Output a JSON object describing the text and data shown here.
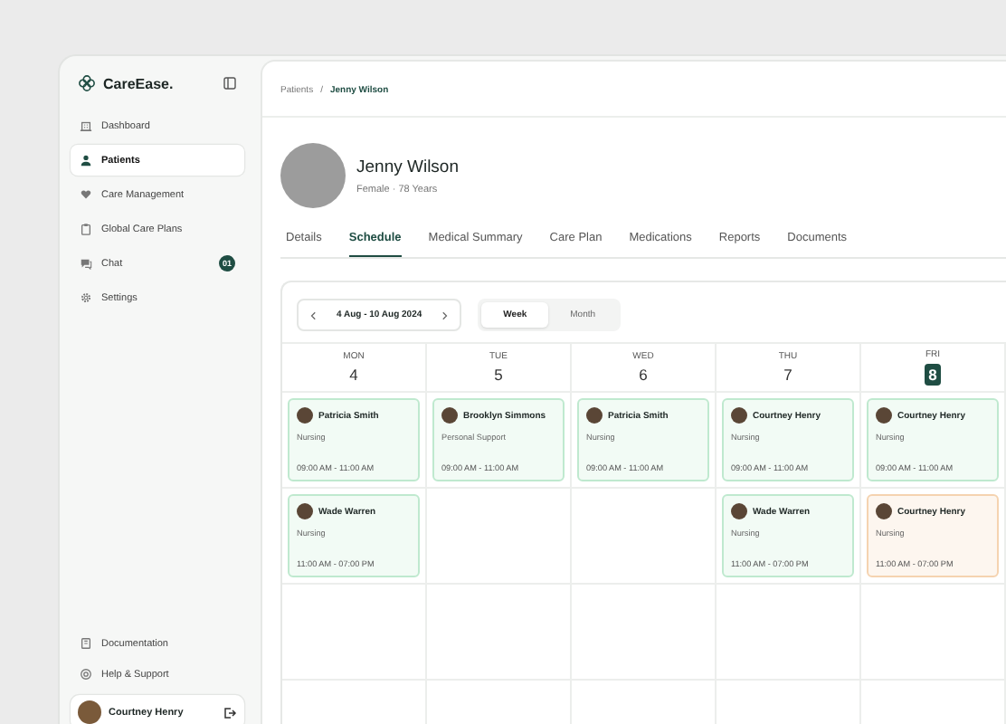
{
  "sidebar": {
    "brand": "CareEase.",
    "items": [
      {
        "label": "Dashboard",
        "selected": false
      },
      {
        "label": "Patients",
        "selected": true
      },
      {
        "label": "Care Management",
        "selected": false
      },
      {
        "label": "Global Care Plans",
        "selected": false
      },
      {
        "label": "Chat",
        "selected": false,
        "badge": "01"
      },
      {
        "label": "Settings",
        "selected": false
      }
    ],
    "footer_items": [
      {
        "label": "Documentation"
      },
      {
        "label": "Help & Support"
      }
    ],
    "user": {
      "name": "Courtney Henry"
    }
  },
  "breadcrumb": {
    "separator": "/",
    "items": [
      {
        "label": "Patients",
        "current": false
      },
      {
        "label": "Jenny Wilson",
        "current": true
      }
    ]
  },
  "patient": {
    "name": "Jenny Wilson",
    "details": "Female · 78 Years"
  },
  "tabs": [
    {
      "label": "Details",
      "selected": false
    },
    {
      "label": "Schedule",
      "selected": true
    },
    {
      "label": "Medical Summary",
      "selected": false
    },
    {
      "label": "Care Plan",
      "selected": false
    },
    {
      "label": "Medications",
      "selected": false
    },
    {
      "label": "Reports",
      "selected": false
    },
    {
      "label": "Documents",
      "selected": false
    }
  ],
  "schedule": {
    "range": "4 Aug - 10 Aug 2024",
    "views": [
      {
        "label": "Week",
        "selected": true
      },
      {
        "label": "Month",
        "selected": false
      }
    ],
    "days": [
      {
        "name": "MON",
        "number": "4",
        "today": false,
        "events": [
          {
            "carer": "Patricia Smith",
            "service": "Nursing",
            "time": "09:00 AM - 11:00 AM",
            "color": "#bfe9cf"
          },
          {
            "carer": "Wade Warren",
            "service": "Nursing",
            "time": "11:00 AM - 07:00 PM",
            "color": "#bfe9cf"
          }
        ]
      },
      {
        "name": "TUE",
        "number": "5",
        "today": false,
        "events": [
          {
            "carer": "Brooklyn Simmons",
            "service": "Personal Support",
            "time": "09:00 AM - 11:00 AM",
            "color": "#bfe9cf"
          }
        ]
      },
      {
        "name": "WED",
        "number": "6",
        "today": false,
        "events": [
          {
            "carer": "Patricia Smith",
            "service": "Nursing",
            "time": "09:00 AM - 11:00 AM",
            "color": "#bfe9cf"
          }
        ]
      },
      {
        "name": "THU",
        "number": "7",
        "today": false,
        "events": [
          {
            "carer": "Courtney Henry",
            "service": "Nursing",
            "time": "09:00 AM - 11:00 AM",
            "color": "#bfe9cf"
          },
          {
            "carer": "Wade Warren",
            "service": "Nursing",
            "time": "11:00 AM - 07:00 PM",
            "color": "#bfe9cf"
          }
        ]
      },
      {
        "name": "FRI",
        "number": "8",
        "today": true,
        "events": [
          {
            "carer": "Courtney Henry",
            "service": "Nursing",
            "time": "09:00 AM - 11:00 AM",
            "color": "#bfe9cf"
          },
          {
            "carer": "Courtney Henry",
            "service": "Nursing",
            "time": "11:00 AM - 07:00 PM",
            "color": "#f5d3b0"
          }
        ]
      }
    ]
  }
}
